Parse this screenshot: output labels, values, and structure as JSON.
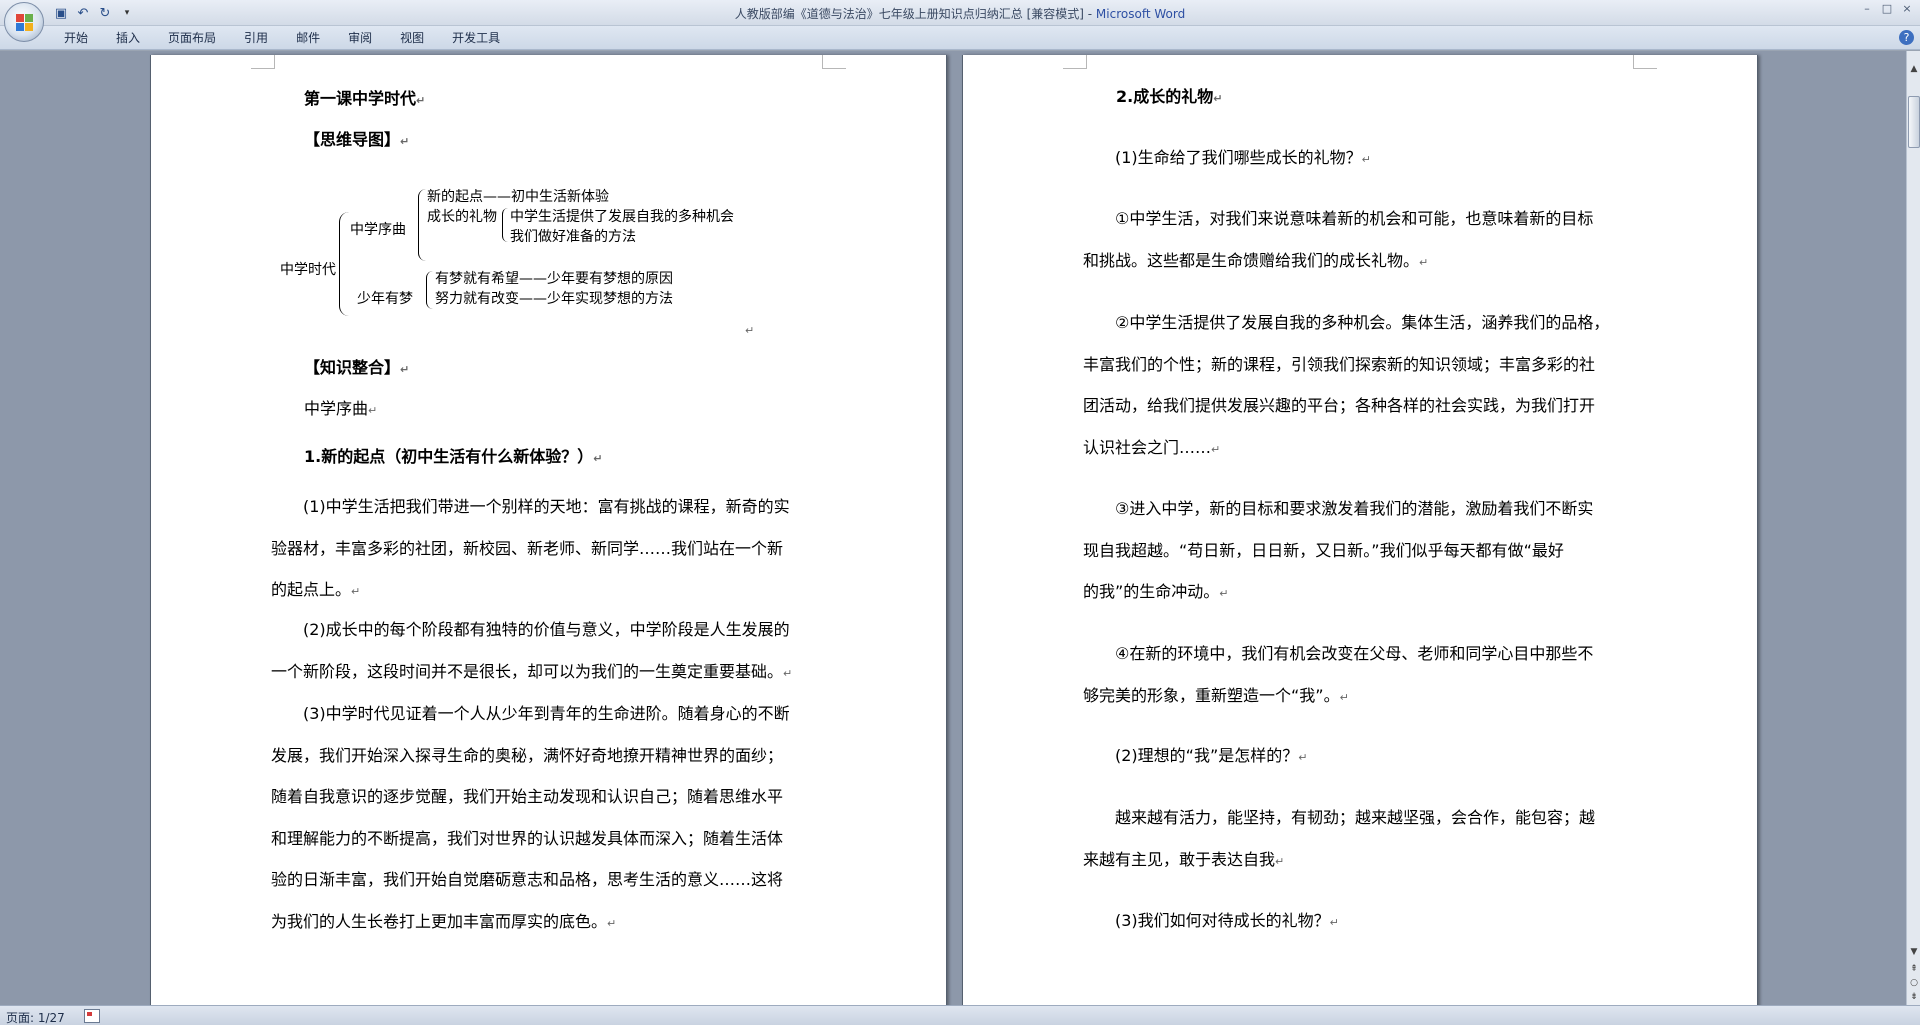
{
  "window": {
    "title_doc": "人教版部编《道德与法治》七年级上册知识点归纳汇总 [兼容模式] - ",
    "title_app": "Microsoft Word",
    "minimize": "–",
    "maximize": "□",
    "close": "×"
  },
  "ribbon": {
    "tabs": [
      "开始",
      "插入",
      "页面布局",
      "引用",
      "邮件",
      "审阅",
      "视图",
      "开发工具"
    ],
    "help": "?"
  },
  "qat": {
    "save": "▣",
    "undo": "↶",
    "redo": "↻",
    "more": "▾"
  },
  "left_page": {
    "lesson_title": "第一课中学时代",
    "mindmap_heading": "【思维导图】",
    "mindmap": {
      "root": "中学时代",
      "branch1": "中学序曲",
      "b1_item1": "新的起点——初中生活新体验",
      "b1_item2": "成长的礼物",
      "b1_item2_sub1": "中学生活提供了发展自我的多种机会",
      "b1_item2_sub2": "我们做好准备的方法",
      "branch2": "少年有梦",
      "b2_item1": "有梦就有希望——少年要有梦想的原因",
      "b2_item2": "努力就有改变——少年实现梦想的方法"
    },
    "knowledge_heading": "【知识整合】",
    "section_label": "中学序曲",
    "h1": "1.新的起点（初中生活有什么新体验？）",
    "p1": [
      "　　(1)中学生活把我们带进一个别样的天地：富有挑战的课程，新奇的实",
      "验器材，丰富多彩的社团，新校园、新老师、新同学……我们站在一个新",
      "的起点上。"
    ],
    "p2": [
      "　　(2)成长中的每个阶段都有独特的价值与意义，中学阶段是人生发展的",
      "一个新阶段，这段时间并不是很长，却可以为我们的一生奠定重要基础。"
    ],
    "p3": [
      "　　(3)中学时代见证着一个人从少年到青年的生命进阶。随着身心的不断",
      "发展，我们开始深入探寻生命的奥秘，满怀好奇地撩开精神世界的面纱；",
      "随着自我意识的逐步觉醒，我们开始主动发现和认识自己；随着思维水平",
      "和理解能力的不断提高，我们对世界的认识越发具体而深入；随着生活体",
      "验的日渐丰富，我们开始自觉磨砺意志和品格，思考生活的意义……这将",
      "为我们的人生长卷打上更加丰富而厚实的底色。"
    ]
  },
  "right_page": {
    "h2": "2.成长的礼物",
    "q1": "　　(1)生命给了我们哪些成长的礼物？",
    "r1": [
      "　　①中学生活，对我们来说意味着新的机会和可能，也意味着新的目标",
      "和挑战。这些都是生命馈赠给我们的成长礼物。"
    ],
    "r2": [
      "　　②中学生活提供了发展自我的多种机会。集体生活，涵养我们的品格，",
      "丰富我们的个性；新的课程，引领我们探索新的知识领域；丰富多彩的社",
      "团活动，给我们提供发展兴趣的平台；各种各样的社会实践，为我们打开",
      "认识社会之门……"
    ],
    "r3": [
      "　　③进入中学，新的目标和要求激发着我们的潜能，激励着我们不断实",
      "现自我超越。“苟日新，日日新，又日新。”我们似乎每天都有做“最好",
      "的我”的生命冲动。"
    ],
    "r4": [
      "　　④在新的环境中，我们有机会改变在父母、老师和同学心目中那些不",
      "够完美的形象，重新塑造一个“我”。"
    ],
    "q2": "　　(2)理想的“我”是怎样的？",
    "r5": [
      "　　越来越有活力，能坚持，有韧劲；越来越坚强，会合作，能包容；越",
      "来越有主见，敢于表达自我"
    ],
    "q3": "　　(3)我们如何对待成长的礼物？"
  },
  "status": {
    "page": "页面: 1/27"
  },
  "return_mark": "↵"
}
